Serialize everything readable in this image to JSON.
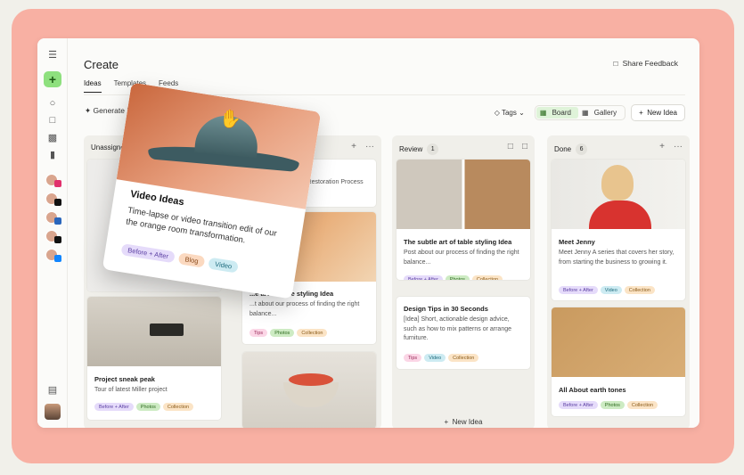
{
  "app": {
    "title": "Create",
    "feedback_label": "Share Feedback"
  },
  "tabs": [
    "Ideas",
    "Templates",
    "Feeds"
  ],
  "toolbar": {
    "generate_label": "Generate Idea",
    "tags_label": "Tags",
    "board_label": "Board",
    "gallery_label": "Gallery",
    "new_idea_label": "New Idea"
  },
  "columns": {
    "unassigned": {
      "name": "Unassigned"
    },
    "review": {
      "name": "Review",
      "count": "1"
    },
    "done": {
      "name": "Done",
      "count": "6"
    }
  },
  "cards": {
    "sourcing": {
      "desc": "...: Sourcing Edition. Restoration Process"
    },
    "table_styling_a": {
      "title": "...e art of table styling Idea",
      "desc": "...t about our process of finding the right balance..."
    },
    "sneak_peak": {
      "title": "Project sneak peak",
      "desc": "Tour of latest Miller project"
    },
    "table_styling_b": {
      "title": "The subtle art of table styling Idea",
      "desc": "Post about our process of finding the right balance..."
    },
    "design_tips": {
      "title": "Design Tips in 30 Seconds",
      "desc": "[Idea] Short, actionable design advice, such as how to mix patterns or arrange furniture."
    },
    "meet_jenny": {
      "title": "Meet Jenny",
      "desc": "Meet Jenny A series that covers her story, from starting the business to growing it."
    },
    "earth_tones": {
      "title": "All About earth tones"
    },
    "dragged": {
      "title": "Video Ideas",
      "desc": "Time-lapse or video transition edit of our the orange room transformation."
    }
  },
  "chips": {
    "before_after": "Before + After",
    "photos": "Photos",
    "collection": "Collection",
    "tips": "Tips",
    "video": "Video",
    "blog": "Blog",
    "video_cap": "Video"
  },
  "review_new_idea": "New Idea",
  "colors": {
    "frame": "#f8b0a3",
    "accent_green": "#8ee07e"
  }
}
